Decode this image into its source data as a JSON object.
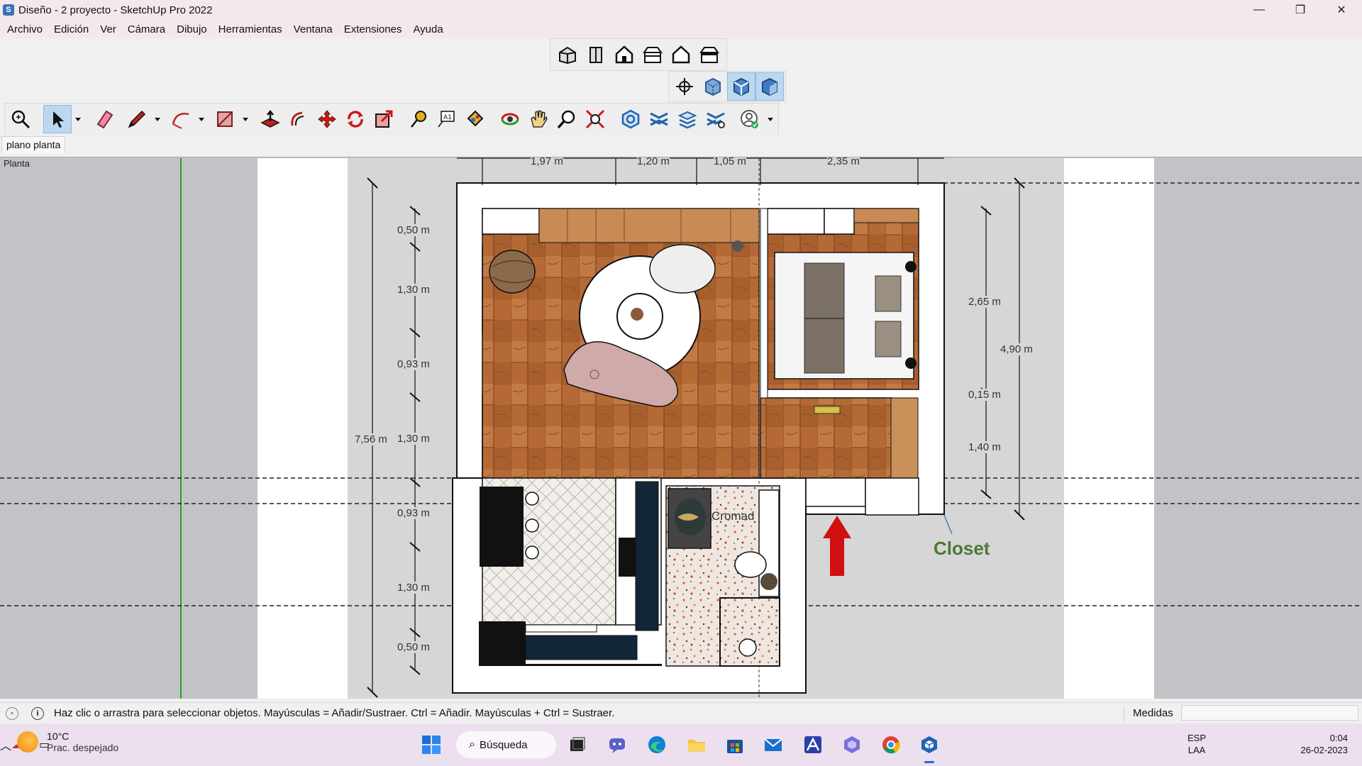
{
  "window": {
    "app_icon": "sketchup-icon",
    "title": "Diseño - 2 proyecto - SketchUp Pro 2022",
    "minimize_glyph": "—",
    "maximize_glyph": "❐",
    "close_glyph": "✕"
  },
  "menu": [
    {
      "label": "Archivo"
    },
    {
      "label": "Edición"
    },
    {
      "label": "Ver"
    },
    {
      "label": "Cámara"
    },
    {
      "label": "Dibujo"
    },
    {
      "label": "Herramientas"
    },
    {
      "label": "Ventana"
    },
    {
      "label": "Extensiones"
    },
    {
      "label": "Ayuda"
    }
  ],
  "views_toolbar": [
    "iso-view-icon",
    "top-view-icon",
    "front-view-icon",
    "right-view-icon",
    "back-view-icon",
    "left-view-icon"
  ],
  "style_toolbar": [
    "xray-icon",
    "back-edges-icon",
    "wireframe-icon",
    "shaded-icon"
  ],
  "main_toolbar": [
    "zoom-extents-icon",
    "select-icon",
    "eraser-icon",
    "pencil-line-icon",
    "arc-icon",
    "rectangle-icon",
    "push-pull-icon",
    "offset-icon",
    "move-icon",
    "rotate-icon",
    "scale-icon",
    "tape-measure-icon",
    "text-icon",
    "paint-bucket-icon",
    "orbit-icon",
    "pan-icon",
    "zoom-icon",
    "zoom-window-icon",
    "section-plane-icon",
    "section-display-icon",
    "layers-icon",
    "tags-settings-icon",
    "account-icon"
  ],
  "scene_tab": {
    "label": "plano planta"
  },
  "viewport": {
    "label": "Planta",
    "dimensions_top": [
      "1,97 m",
      "1,20 m",
      "1,05 m",
      "2,35 m"
    ],
    "dimensions_left": [
      "0,50 m",
      "1,30 m",
      "0,93 m",
      "1,30 m",
      "0,93 m",
      "1,30 m",
      "0,50 m"
    ],
    "dimension_total_left": "7,56 m",
    "dimensions_right": [
      "2,65 m",
      "0,15 m",
      "1,40 m"
    ],
    "dimension_total_right": "4,90 m",
    "room_label_bath": "Cromad",
    "closet_label": "Closet",
    "colors": {
      "closet_label": "#4a7a36",
      "arrow": "#d01010",
      "wood": "#b56a35",
      "axis_green": "#22a322"
    }
  },
  "status": {
    "hint": "Haz clic o arrastra para seleccionar objetos. Mayúsculas = Añadir/Sustraer. Ctrl = Añadir. Mayúsculas + Ctrl = Sustraer.",
    "measurements_label": "Medidas",
    "measurements_value": ""
  },
  "taskbar": {
    "weather_temp": "10°C",
    "weather_cond": "Prac. despejado",
    "search_label": "Búsqueda",
    "apps": [
      "windows-start-icon",
      "task-view-icon",
      "teams-icon",
      "edge-icon",
      "file-explorer-icon",
      "store-icon",
      "mail-icon",
      "autocad-icon",
      "copilot-icon",
      "chrome-icon",
      "sketchup-icon"
    ],
    "lang_top": "ESP",
    "lang_bottom": "LAA",
    "time": "0:04",
    "date": "26-02-2023"
  }
}
